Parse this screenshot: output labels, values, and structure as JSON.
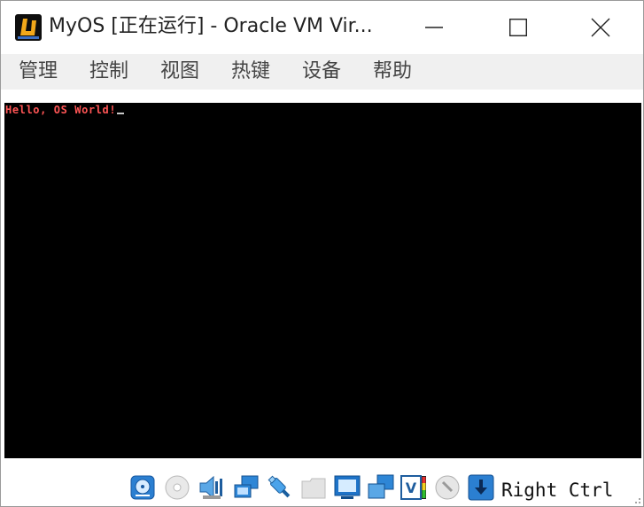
{
  "window": {
    "title": "MyOS [正在运行] - Oracle VM Vir..."
  },
  "menu": {
    "items": [
      "管理",
      "控制",
      "视图",
      "热键",
      "设备",
      "帮助"
    ]
  },
  "vm": {
    "console_text": "Hello, OS World!"
  },
  "status": {
    "icons": [
      "hard-disk-icon",
      "optical-drive-icon",
      "audio-icon",
      "network-icon",
      "usb-icon",
      "shared-folder-icon",
      "display-icon",
      "capture-icon",
      "cpu-activity-icon",
      "mouse-integration-icon",
      "host-key-icon"
    ],
    "host_key": "Right Ctrl"
  },
  "colors": {
    "console_text": "#ff5555",
    "console_bg": "#000000",
    "menubar_bg": "#f0f0f0",
    "icon_blue": "#1e73c8"
  }
}
